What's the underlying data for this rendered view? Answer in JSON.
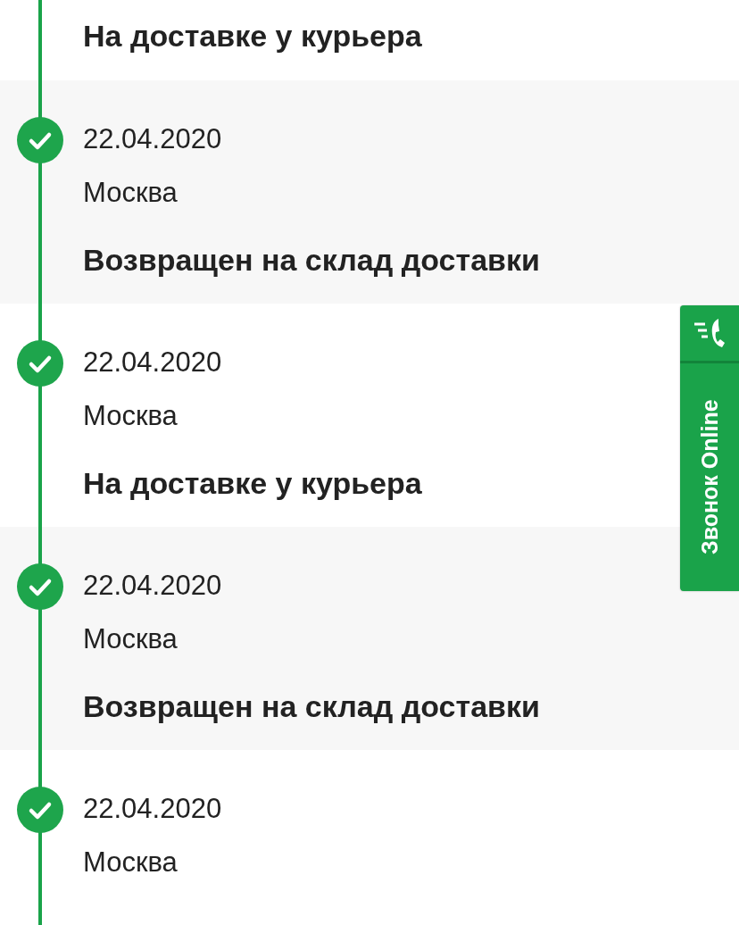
{
  "timeline": [
    {
      "status": "На доставке у курьера"
    },
    {
      "date": "22.04.2020",
      "city": "Москва",
      "status": "Возвращен на склад доставки"
    },
    {
      "date": "22.04.2020",
      "city": "Москва",
      "status": "На доставке у курьера"
    },
    {
      "date": "22.04.2020",
      "city": "Москва",
      "status": "Возвращен на склад доставки"
    },
    {
      "date": "22.04.2020",
      "city": "Москва"
    }
  ],
  "call_widget": {
    "label": "Звонок Online"
  }
}
